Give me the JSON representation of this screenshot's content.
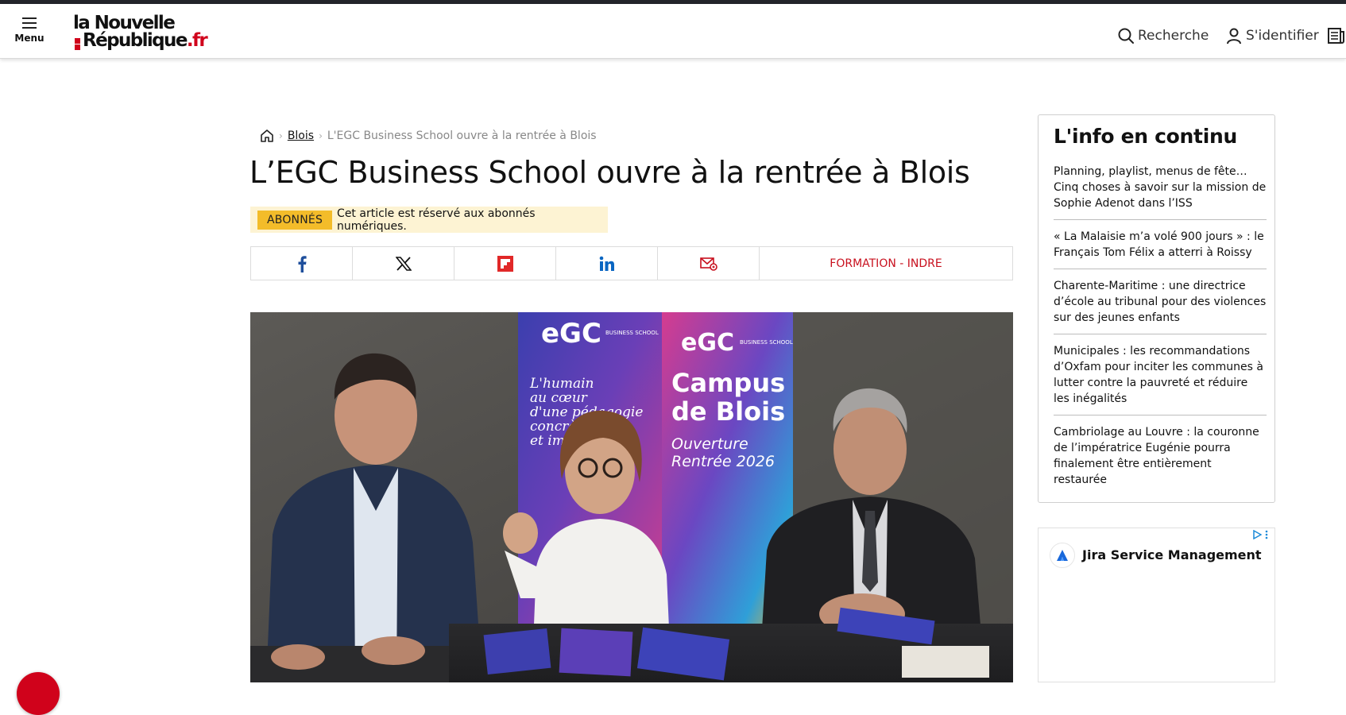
{
  "header": {
    "menu_label": "Menu",
    "logo_line1": "la Nouvelle",
    "logo_line2": "République",
    "logo_suffix": ".fr",
    "search_label": "Recherche",
    "login_label": "S'identifier",
    "icons": [
      "menu-icon",
      "search-icon",
      "user-icon",
      "newspaper-icon"
    ]
  },
  "breadcrumb": {
    "home_icon": "home-icon",
    "section": "Blois",
    "current": "L'EGC Business School ouvre à la rentrée à Blois"
  },
  "article": {
    "title": "L’EGC Business School ouvre à la rentrée à Blois",
    "premium_badge": "ABONNÉS",
    "premium_text": "Cet article est réservé aux abonnés numériques.",
    "tag": "FORMATION - INDRE",
    "share_icons": [
      "facebook-icon",
      "x-icon",
      "flipboard-icon",
      "linkedin-icon",
      "email-icon"
    ]
  },
  "photo": {
    "banner1_logo": "eGC",
    "banner1_sub": "BUSINESS SCHOOL",
    "banner1_text": [
      "L'humain",
      "au cœur",
      "d'une pédagogie",
      "concrète",
      "et immersive"
    ],
    "banner2_logo": "eGC",
    "banner2_sub": "BUSINESS SCHOOL",
    "banner2_text": [
      "Campus",
      "de Blois"
    ],
    "banner2_text2": [
      "Ouverture",
      "Rentrée 2026"
    ]
  },
  "sidebar": {
    "title": "L'info en continu",
    "items": [
      "Planning, playlist, menus de fête… Cinq choses à savoir sur la mission de Sophie Adenot dans l’ISS",
      "« La Malaisie m’a volé 900 jours » : le Français Tom Félix a atterri à Roissy",
      "Charente-Maritime : une directrice d’école au tribunal pour des violences sur des jeunes enfants",
      "Municipales : les recommandations d’Oxfam pour inciter les communes à lutter contre la pauvreté et réduire les inégalités",
      "Cambriolage au Louvre : la couronne de l’impératrice Eugénie pourra finalement être entièrement restaurée"
    ]
  },
  "ad": {
    "title": "Jira Service Management"
  },
  "colors": {
    "brand_red": "#d0021b",
    "premium_badge": "#f3bc2a",
    "premium_bg": "#fdf3d3",
    "tag_red": "#c8101e",
    "facebook": "#1877f2",
    "linkedin": "#0a66c2"
  }
}
